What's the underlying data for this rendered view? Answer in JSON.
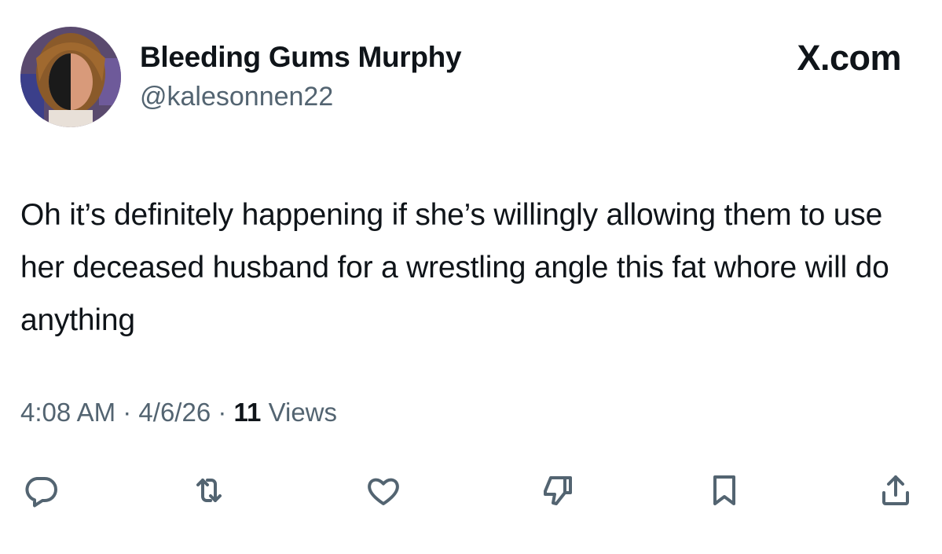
{
  "tweet": {
    "display_name": "Bleeding Gums Murphy",
    "handle": "@kalesonnen22",
    "brand": "X.com",
    "text": "Oh it’s definitely happening if she’s willingly allowing them to use her deceased husband for a wrestling angle this fat whore will do anything",
    "time": "4:08 AM",
    "separator": "·",
    "date": "4/6/26",
    "views_count": "11",
    "views_label": "Views"
  },
  "actions": [
    {
      "name": "reply",
      "icon": "reply-icon"
    },
    {
      "name": "repost",
      "icon": "repost-icon"
    },
    {
      "name": "like",
      "icon": "heart-icon"
    },
    {
      "name": "dislike",
      "icon": "thumbs-down-icon"
    },
    {
      "name": "bookmark",
      "icon": "bookmark-icon"
    },
    {
      "name": "share",
      "icon": "share-icon"
    }
  ],
  "colors": {
    "text_primary": "#0f1419",
    "text_secondary": "#536471",
    "background": "#ffffff"
  }
}
